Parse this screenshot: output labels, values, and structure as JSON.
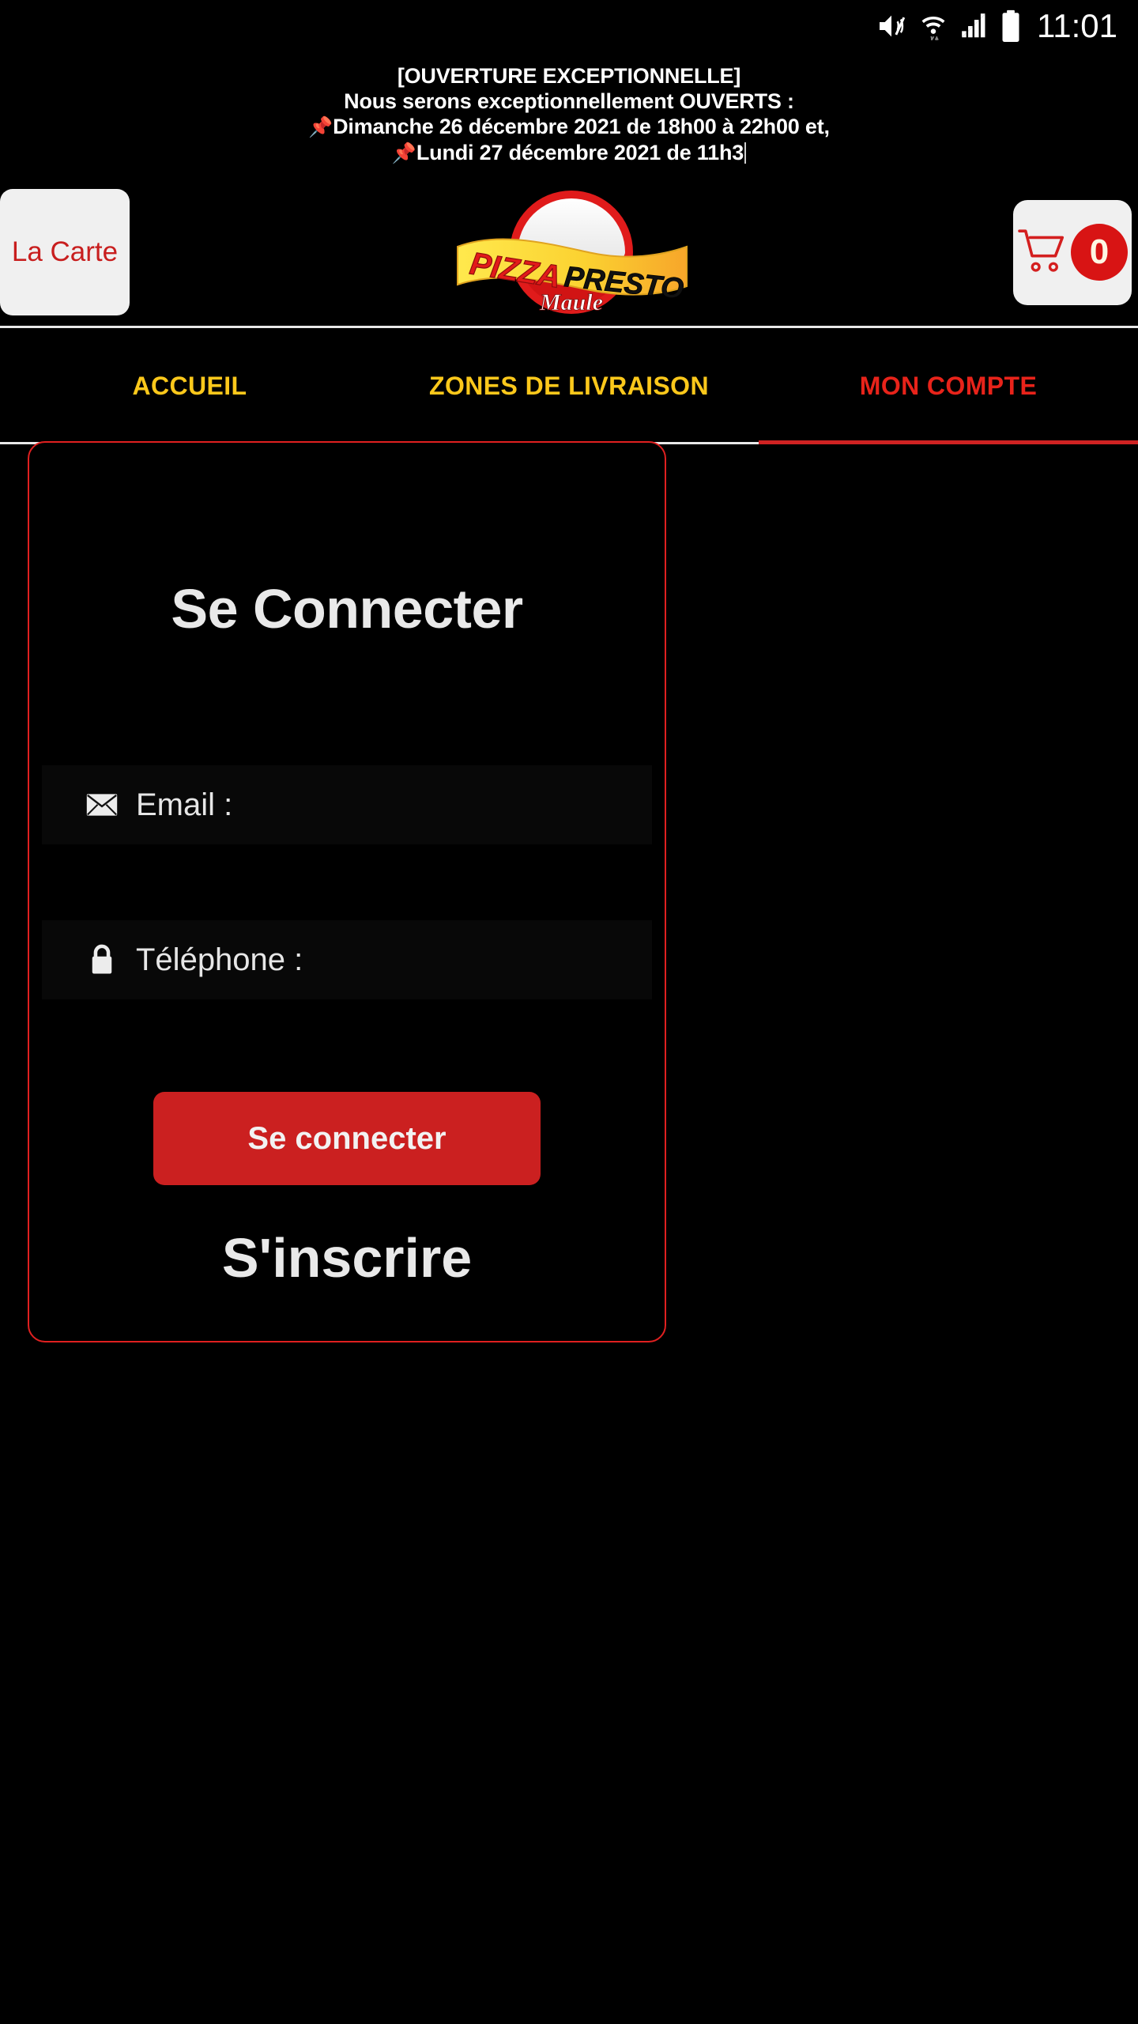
{
  "status_bar": {
    "time": "11:01",
    "icons": [
      "mute-icon",
      "wifi-icon",
      "signal-icon",
      "battery-icon"
    ]
  },
  "announcement": {
    "line1": "[OUVERTURE EXCEPTIONNELLE]",
    "line2": "Nous serons exceptionnellement OUVERTS :",
    "line3_pin": "📌",
    "line3": "Dimanche 26 décembre 2021 de 18h00 à 22h00 et,",
    "line4_pin": "📌",
    "line4": "Lundi 27 décembre 2021 de 11h3"
  },
  "header": {
    "menu_button_label": "La Carte",
    "cart_count": "0",
    "logo": {
      "word1": "PIZZA",
      "word2": "PRESTO",
      "city": "Maule"
    }
  },
  "nav": {
    "tabs": [
      {
        "label": "ACCUEIL",
        "active": false
      },
      {
        "label": "ZONES DE LIVRAISON",
        "active": false
      },
      {
        "label": "MON COMPTE",
        "active": true
      }
    ]
  },
  "login_card": {
    "title": "Se Connecter",
    "email_label": "Email :",
    "email_value": "",
    "phone_label": "Téléphone :",
    "phone_value": "",
    "submit_label": "Se connecter",
    "signup_label": "S'inscrire"
  },
  "colors": {
    "background": "#000000",
    "brand_red": "#cb2020",
    "accent_yellow": "#fcc81b",
    "tab_active_red": "#e8231a",
    "card_border": "#e02020",
    "button_light": "#f0f0f0"
  }
}
